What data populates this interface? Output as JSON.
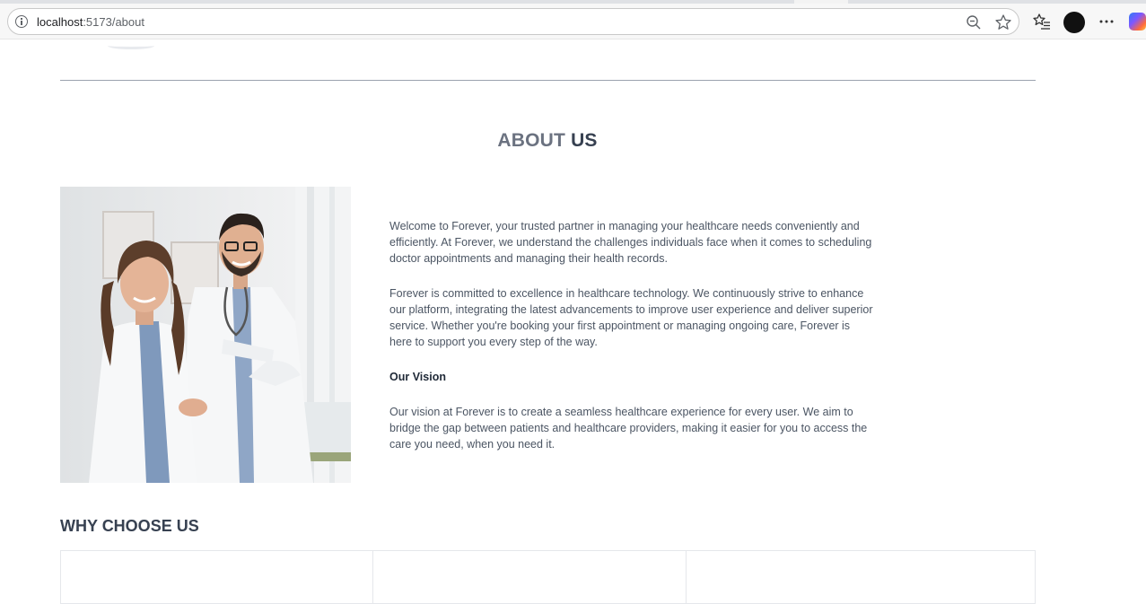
{
  "browser": {
    "url_host": "localhost",
    "url_path": ":5173/about",
    "icons": [
      "info-icon",
      "zoom-out-icon",
      "favorite-star-icon",
      "favorites-list-icon",
      "profile-avatar",
      "more-icon",
      "copilot-icon"
    ]
  },
  "about": {
    "title_light": "ABOUT",
    "title_bold": "US",
    "paragraph_1": "Welcome to Forever, your trusted partner in managing your healthcare needs conveniently and efficiently. At Forever, we understand the challenges individuals face when it comes to scheduling doctor appointments and managing their health records.",
    "paragraph_2": "Forever is committed to excellence in healthcare technology. We continuously strive to enhance our platform, integrating the latest advancements to improve user experience and deliver superior service. Whether you're booking your first appointment or managing ongoing care, Forever is here to support you every step of the way.",
    "vision_heading": "Our Vision",
    "vision_text": "Our vision at Forever is to create a seamless healthcare experience for every user. We aim to bridge the gap between patients and healthcare providers, making it easier for you to access the care you need, when you need it."
  },
  "why": {
    "title_light": "WHY",
    "title_bold": "CHOOSE US"
  },
  "colors": {
    "title_gray": "#6b7280",
    "title_dark": "#374151",
    "body_text": "#4b5563",
    "divider": "#9ca3af",
    "card_border": "#e5e7eb"
  }
}
